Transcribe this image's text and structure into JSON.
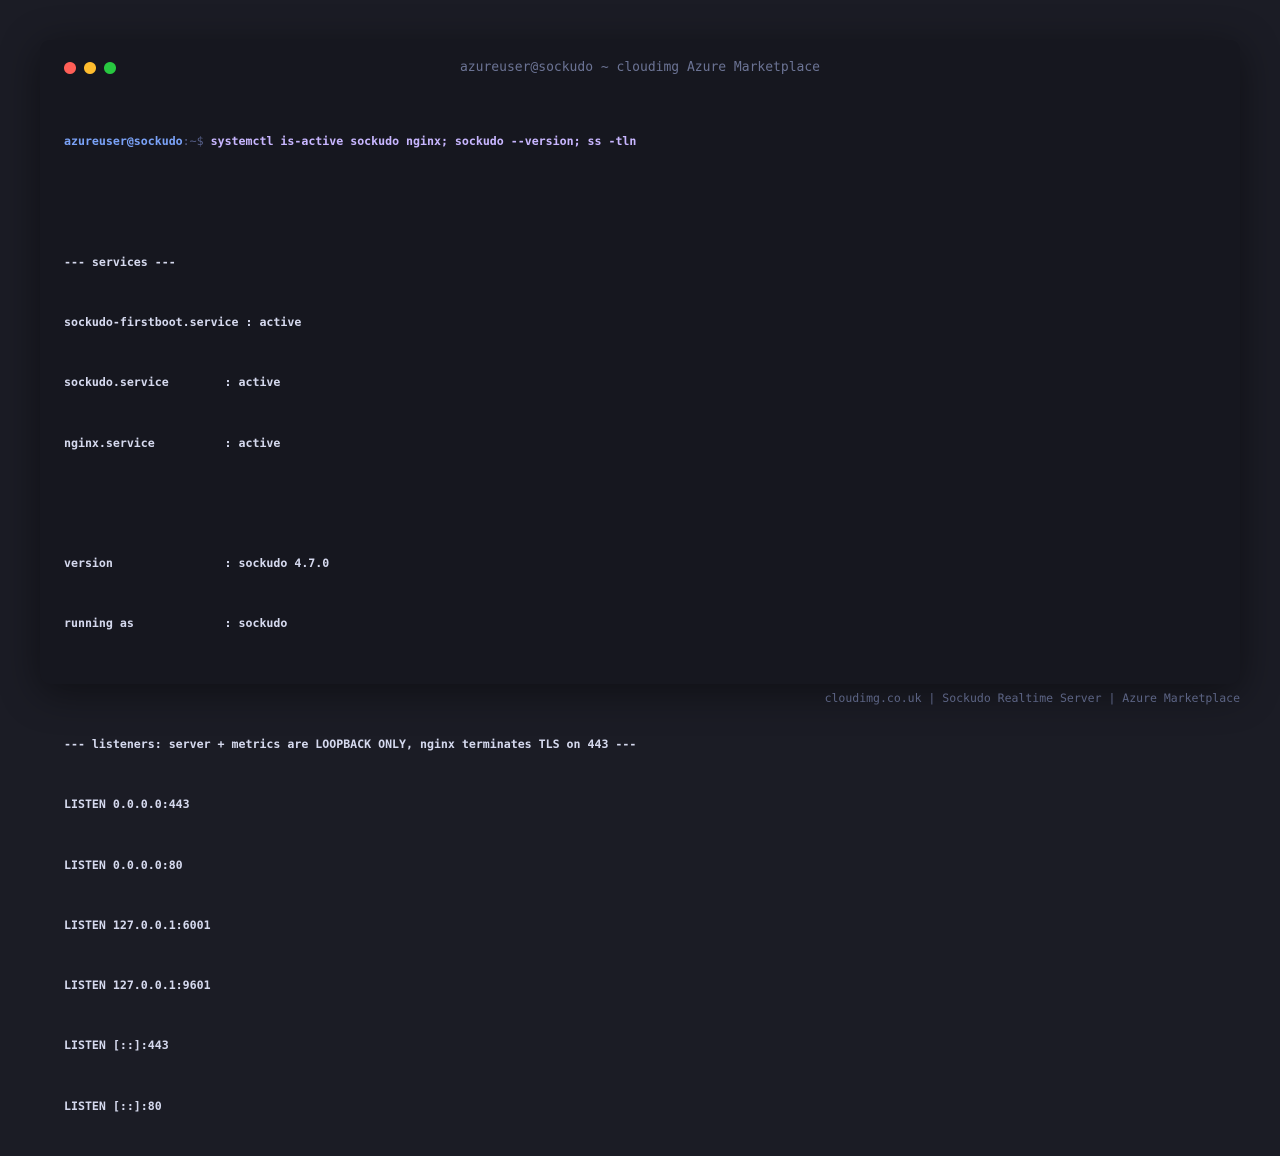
{
  "window": {
    "title": "azureuser@sockudo ~ cloudimg Azure Marketplace",
    "controls": [
      {
        "name": "close",
        "color": "#ff5f57"
      },
      {
        "name": "minimize",
        "color": "#febc2e"
      },
      {
        "name": "zoom",
        "color": "#28c840"
      }
    ]
  },
  "terminal": {
    "prompt": {
      "user_host": "azureuser@sockudo",
      "path_symbol": ":~$",
      "command": "systemctl is-active sockudo nginx; sockudo --version; ss -tln"
    },
    "services": {
      "header": "--- services ---",
      "lines": [
        "sockudo-firstboot.service : active",
        "sockudo.service        : active",
        "nginx.service          : active"
      ]
    },
    "info": {
      "lines": [
        "version                : sockudo 4.7.0",
        "running as             : sockudo"
      ]
    },
    "listeners": {
      "header": "--- listeners: server + metrics are LOOPBACK ONLY, nginx terminates TLS on 443 ---",
      "lines": [
        "LISTEN 0.0.0.0:443",
        "LISTEN 0.0.0.0:80",
        "LISTEN 127.0.0.1:6001",
        "LISTEN 127.0.0.1:9601",
        "LISTEN [::]:443",
        "LISTEN [::]:80"
      ]
    }
  },
  "footer": {
    "text": "cloudimg.co.uk | Sockudo Realtime Server | Azure Marketplace"
  },
  "colors": {
    "page_background": "#1b1c25",
    "terminal_background": "#16171f",
    "prompt_user": "#7aa2f7",
    "command": "#c8b6ff",
    "output_text": "#d5d9ee",
    "muted_text": "#6b7394"
  }
}
